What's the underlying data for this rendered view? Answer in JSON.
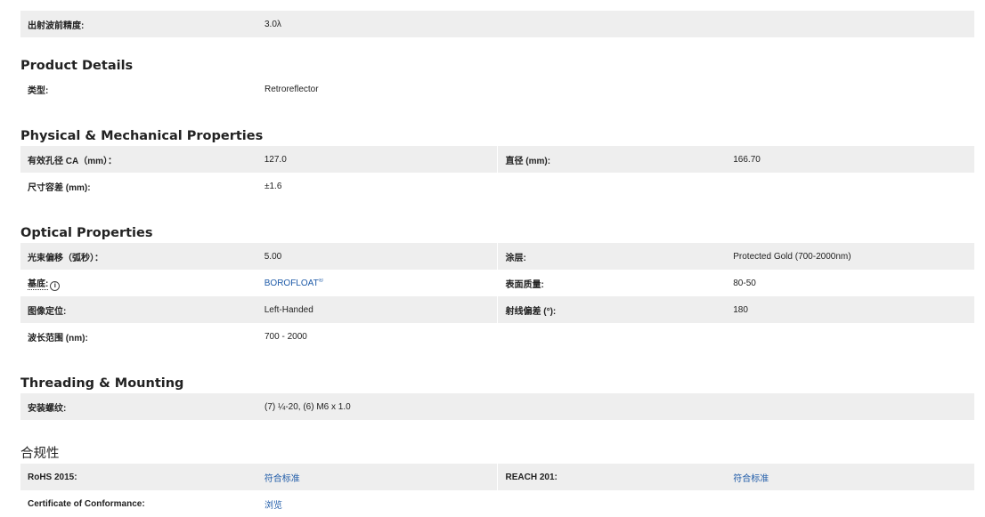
{
  "top_table": {
    "rows": [
      {
        "label": "出射波前精度:",
        "value": "3.0λ"
      }
    ]
  },
  "product_details": {
    "title": "Product Details",
    "rows": [
      {
        "label": "类型:",
        "value": "Retroreflector"
      }
    ]
  },
  "physical": {
    "title": "Physical & Mechanical Properties",
    "rows": [
      {
        "label1": "有效孔径 CA（mm）：",
        "value1": "127.0",
        "label2": "直径 (mm):",
        "value2": "166.70"
      },
      {
        "label1": "尺寸容差 (mm):",
        "value1": "±1.6",
        "label2": "",
        "value2": ""
      }
    ]
  },
  "optical": {
    "title": "Optical Properties",
    "rows": [
      {
        "label1": "光束偏移（弧秒）：",
        "value1": "5.00",
        "label2": "涂层:",
        "value2": "Protected Gold (700-2000nm)"
      },
      {
        "label1": "基底:",
        "value1": "BOROFLOAT",
        "value1_sup": "®",
        "label2": "表面质量:",
        "value2": "80-50"
      },
      {
        "label1": "图像定位:",
        "value1": "Left-Handed",
        "label2": "射线偏差 (°):",
        "value2": "180"
      },
      {
        "label1": "波长范围 (nm):",
        "value1": "700 - 2000",
        "label2": "",
        "value2": ""
      }
    ],
    "substrate_info_icon": "info-circle-icon"
  },
  "threading": {
    "title": "Threading & Mounting",
    "rows": [
      {
        "label": "安装螺纹:",
        "value": "(7) ¼-20, (6) M6 x 1.0"
      }
    ]
  },
  "compliance": {
    "title": "合规性",
    "rows": [
      {
        "label1": "RoHS 2015:",
        "value1": "符合标准",
        "label2": "REACH 201:",
        "value2": "符合标准"
      },
      {
        "label1": "Certificate of Conformance:",
        "value1": "浏览",
        "label2": "",
        "value2": ""
      }
    ]
  },
  "colors": {
    "row_shade": "#eeeeee",
    "link": "#1f5ba8",
    "text": "#222222"
  }
}
